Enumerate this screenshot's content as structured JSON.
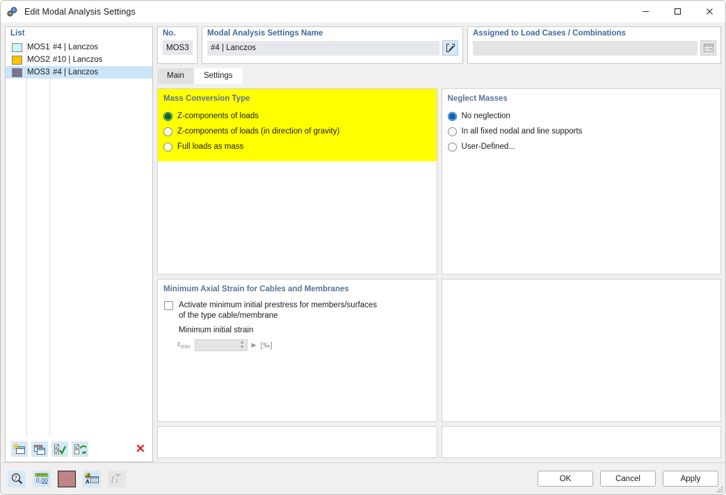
{
  "window": {
    "title": "Edit Modal Analysis Settings",
    "icon": "app-modal-analysis-icon",
    "minimize_label": "—",
    "maximize_label": "☐",
    "close_label": "✕"
  },
  "list_panel": {
    "header": "List",
    "rows": [
      {
        "color": "#c9f5f7",
        "id": "MOS1",
        "description": "#4 | Lanczos",
        "selected": false
      },
      {
        "color": "#ffc400",
        "id": "MOS2",
        "description": "#10 | Lanczos",
        "selected": false
      },
      {
        "color": "#7d7494",
        "id": "MOS3",
        "description": "#4 | Lanczos",
        "selected": true
      }
    ],
    "toolbar": [
      {
        "name": "new-item-button",
        "icon": "new-window-star-icon"
      },
      {
        "name": "copy-item-button",
        "icon": "copy-windows-icon"
      },
      {
        "name": "check-all-button",
        "icon": "checklist-check-icon"
      },
      {
        "name": "refresh-check-button",
        "icon": "checklist-refresh-icon"
      },
      {
        "name": "delete-item-button",
        "icon": "red-x-icon",
        "label": "✕"
      }
    ]
  },
  "fields": {
    "no_label": "No.",
    "no_value": "MOS3",
    "name_label": "Modal Analysis Settings Name",
    "name_value": "#4 | Lanczos",
    "name_edit_icon": "edit-pencil-icon",
    "assigned_label": "Assigned to Load Cases / Combinations",
    "assigned_value": "",
    "assigned_picker_icon": "table-list-icon"
  },
  "tabs": [
    {
      "label": "Main",
      "active": false
    },
    {
      "label": "Settings",
      "active": true
    }
  ],
  "mass_conversion": {
    "title": "Mass Conversion Type",
    "highlight_color": "#ffff00",
    "selected_color": "#0c6b22",
    "options": [
      {
        "label": "Z-components of loads",
        "selected": true
      },
      {
        "label": "Z-components of loads (in direction of gravity)",
        "selected": false
      },
      {
        "label": "Full loads as mass",
        "selected": false
      }
    ]
  },
  "neglect_masses": {
    "title": "Neglect Masses",
    "selected_color": "#0a64b4",
    "options": [
      {
        "label": "No neglection",
        "selected": true
      },
      {
        "label": "In all fixed nodal and line supports",
        "selected": false
      },
      {
        "label": "User-Defined...",
        "selected": false
      }
    ]
  },
  "axial_strain": {
    "title": "Minimum Axial Strain for Cables and Membranes",
    "checkbox_label_line1": "Activate minimum initial prestress for members/surfaces",
    "checkbox_label_line2": "of the type cable/membrane",
    "checkbox_checked": false,
    "sub_label": "Minimum initial strain",
    "symbol": "ε",
    "symbol_sub": "min",
    "value": "",
    "unit": "[‰]",
    "enabled": false
  },
  "footer": {
    "tools": [
      {
        "name": "info-magnifier-button",
        "icon": "magnifier-question-icon"
      },
      {
        "name": "units-button",
        "icon": "units-0.00-icon"
      },
      {
        "name": "color-swatch-button",
        "icon": "color-swatch-icon",
        "color": "#bf8585"
      },
      {
        "name": "display-properties-button",
        "icon": "display-properties-icon"
      },
      {
        "name": "formula-button",
        "icon": "function-fx-icon",
        "enabled": false
      }
    ],
    "actions": [
      {
        "label": "OK",
        "name": "ok-button"
      },
      {
        "label": "Cancel",
        "name": "cancel-button"
      },
      {
        "label": "Apply",
        "name": "apply-button"
      }
    ]
  }
}
